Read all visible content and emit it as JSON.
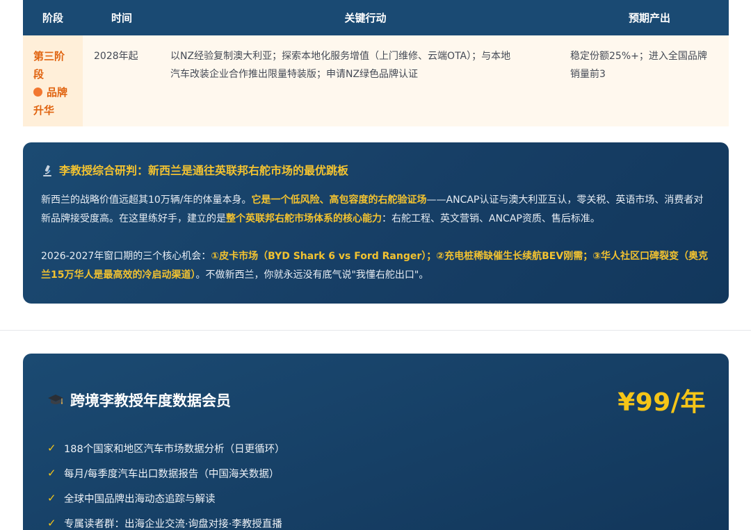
{
  "table": {
    "headers": [
      "阶段",
      "时间",
      "关键行动",
      "预期产出"
    ],
    "row": {
      "phase_line1": "第三阶",
      "phase_line2": "段",
      "phase_line3": "品牌",
      "phase_line4": "升华",
      "time": "2028年起",
      "action_line1": "以NZ经验复制澳大利亚；探索本地化服务增值（上门维修、云端OTA）；与本地",
      "action_line2": "汽车改装企业合作推出限量特装版；申请NZ绿色品牌认证",
      "output_line1": "稳定份额25%+；进入全国品牌",
      "output_line2": "销量前3"
    }
  },
  "analysis": {
    "title": "李教授综合研判：新西兰是通往英联邦右舵市场的最优跳板",
    "p1": {
      "a": "新西兰的战略价值远超其10万辆/年的体量本身。",
      "b": "它是一个低风险、高包容度的右舵验证场",
      "c": "——ANCAP认证与澳大利亚互认，零关税、英语市场、消费者对新品牌接受度高。在这里练好手，建立的是",
      "d": "整个英联邦右舵市场体系的核心能力",
      "e": "：右舵工程、英文营销、ANCAP资质、售后标准。"
    },
    "p2": {
      "a": "2026-2027年窗口期的三个核心机会：",
      "b": "①皮卡市场（BYD Shark 6 vs Ford Ranger）；②充电桩稀缺催生长续航BEV刚需；③华人社区口碑裂变（奥克兰15万华人是最高效的冷启动渠道）",
      "c": "。不做新西兰，你就永远没有底气说\"我懂右舵出口\"。"
    }
  },
  "membership": {
    "title": "跨境李教授年度数据会员",
    "price": "¥99/年",
    "features": [
      "188个国家和地区汽车市场数据分析（日更循环）",
      "每月/每季度汽车出口数据报告（中国海关数据）",
      "全球中国品牌出海动态追踪与解读",
      "专属读者群：出海企业交流·询盘对接·李教授直播"
    ],
    "check_glyph": "✓"
  },
  "colors": {
    "header_bg": "#1a4a73",
    "accent_orange": "#e0630f",
    "accent_gold": "#f2c230",
    "card_bg": "#173f66"
  }
}
